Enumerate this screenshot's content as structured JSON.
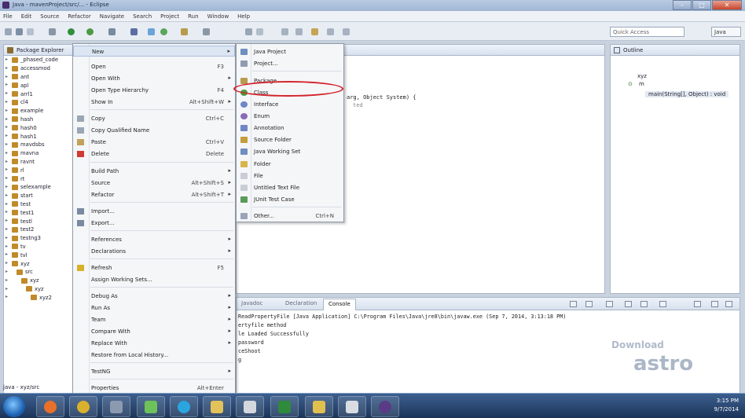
{
  "window": {
    "title": "Java - mavenProject/src/... - Eclipse"
  },
  "menubar": [
    "File",
    "Edit",
    "Source",
    "Refactor",
    "Navigate",
    "Search",
    "Project",
    "Run",
    "Window",
    "Help"
  ],
  "toolbar": {
    "quick_access": "Quick Access",
    "perspective": "Java"
  },
  "package_explorer": {
    "title": "Package Explorer",
    "items": [
      "_phased_code",
      "accessmod",
      "ant",
      "apl",
      "arrl1",
      "cl4",
      "example",
      "hash",
      "hash0",
      "hash1",
      "mavdsbs",
      "mavna",
      "ravnt",
      "rl",
      "rt",
      "selexample",
      "start",
      "test",
      "test1",
      "testl",
      "test2",
      "testng3",
      "tv",
      "tvl",
      "xyz",
      "src",
      "xyz",
      "xyz",
      "xyz2"
    ]
  },
  "context_menu": {
    "items": [
      {
        "label": "New",
        "shortcut": "",
        "submenu": true
      },
      {
        "label": "Open",
        "shortcut": "F3",
        "submenu": false
      },
      {
        "label": "Open With",
        "shortcut": "",
        "submenu": true
      },
      {
        "label": "Open Type Hierarchy",
        "shortcut": "F4",
        "submenu": false
      },
      {
        "label": "Show In",
        "shortcut": "Alt+Shift+W",
        "submenu": true
      },
      {
        "label": "Copy",
        "shortcut": "Ctrl+C",
        "submenu": false
      },
      {
        "label": "Copy Qualified Name",
        "shortcut": "",
        "submenu": false
      },
      {
        "label": "Paste",
        "shortcut": "Ctrl+V",
        "submenu": false
      },
      {
        "label": "Delete",
        "shortcut": "Delete",
        "submenu": false
      },
      {
        "label": "Build Path",
        "shortcut": "",
        "submenu": true
      },
      {
        "label": "Source",
        "shortcut": "Alt+Shift+S",
        "submenu": true
      },
      {
        "label": "Refactor",
        "shortcut": "Alt+Shift+T",
        "submenu": true
      },
      {
        "label": "Import...",
        "shortcut": "",
        "submenu": false
      },
      {
        "label": "Export...",
        "shortcut": "",
        "submenu": false
      },
      {
        "label": "References",
        "shortcut": "",
        "submenu": true
      },
      {
        "label": "Declarations",
        "shortcut": "",
        "submenu": true
      },
      {
        "label": "Refresh",
        "shortcut": "F5",
        "submenu": false
      },
      {
        "label": "Assign Working Sets...",
        "shortcut": "",
        "submenu": false
      },
      {
        "label": "Debug As",
        "shortcut": "",
        "submenu": true
      },
      {
        "label": "Run As",
        "shortcut": "",
        "submenu": true
      },
      {
        "label": "Team",
        "shortcut": "",
        "submenu": true
      },
      {
        "label": "Compare With",
        "shortcut": "",
        "submenu": true
      },
      {
        "label": "Replace With",
        "shortcut": "",
        "submenu": true
      },
      {
        "label": "Restore from Local History...",
        "shortcut": "",
        "submenu": false
      },
      {
        "label": "TestNG",
        "shortcut": "",
        "submenu": true
      },
      {
        "label": "Properties",
        "shortcut": "Alt+Enter",
        "submenu": false
      }
    ]
  },
  "new_submenu": {
    "items": [
      {
        "label": "Java Project",
        "shortcut": ""
      },
      {
        "label": "Project...",
        "shortcut": ""
      },
      {
        "label": "Package",
        "shortcut": ""
      },
      {
        "label": "Class",
        "shortcut": ""
      },
      {
        "label": "Interface",
        "shortcut": ""
      },
      {
        "label": "Enum",
        "shortcut": ""
      },
      {
        "label": "Annotation",
        "shortcut": ""
      },
      {
        "label": "Source Folder",
        "shortcut": ""
      },
      {
        "label": "Java Working Set",
        "shortcut": ""
      },
      {
        "label": "Folder",
        "shortcut": ""
      },
      {
        "label": "File",
        "shortcut": ""
      },
      {
        "label": "Untitled Text File",
        "shortcut": ""
      },
      {
        "label": "JUnit Test Case",
        "shortcut": ""
      },
      {
        "label": "Other...",
        "shortcut": "Ctrl+N"
      }
    ]
  },
  "editor": {
    "code_lines": [
      "arg, Object System) {",
      "ted"
    ]
  },
  "outline": {
    "title": "Outline",
    "rows": [
      "xyz",
      "m",
      "main(String[], Object) : void"
    ]
  },
  "console": {
    "tabs": [
      "Javadoc",
      "Declaration",
      "Console"
    ],
    "lines": [
      "ReadPropertyFile [Java Application] C:\\Program Files\\Java\\jre8\\bin\\javaw.exe (Sep 7, 2014, 3:13:18 PM)",
      "ertyfile method",
      "le Loaded Successfully",
      "password",
      "ceShoot",
      "g"
    ]
  },
  "statusbar": {
    "text": "java - xyz/src"
  },
  "watermark": {
    "line1": "Download",
    "line2": "astro"
  },
  "tray": {
    "time": "3:15 PM",
    "date": "9/7/2014"
  }
}
